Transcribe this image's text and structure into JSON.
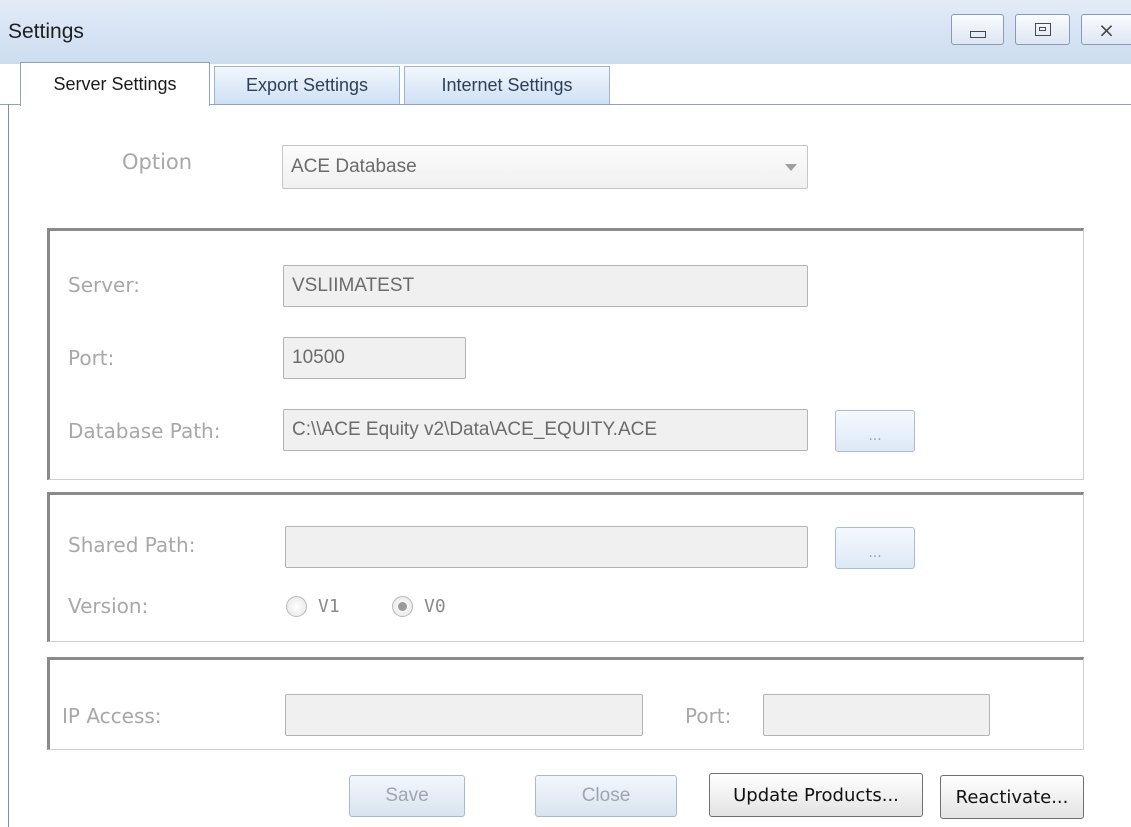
{
  "window": {
    "title": "Settings"
  },
  "tabs": [
    {
      "label": "Server Settings",
      "active": true
    },
    {
      "label": "Export Settings",
      "active": false
    },
    {
      "label": "Internet Settings",
      "active": false
    }
  ],
  "option": {
    "label": "Option",
    "selected": "ACE Database"
  },
  "server_group": {
    "server_label": "Server:",
    "server_value": "VSLIIMATEST",
    "port_label": "Port:",
    "port_value": "10500",
    "db_path_label": "Database Path:",
    "db_path_value": "C:\\\\ACE Equity v2\\Data\\ACE_EQUITY.ACE",
    "browse_label": "..."
  },
  "shared_group": {
    "shared_path_label": "Shared Path:",
    "shared_path_value": "",
    "browse_label": "...",
    "version_label": "Version:",
    "versions": [
      {
        "label": "V1",
        "checked": false
      },
      {
        "label": "V0",
        "checked": true
      }
    ]
  },
  "ip_group": {
    "ip_label": "IP Access:",
    "ip_value": "",
    "port_label": "Port:",
    "port_value": ""
  },
  "buttons": {
    "save": "Save",
    "close": "Close",
    "update_products": "Update Products...",
    "reactivate": "Reactivate..."
  },
  "colors": {
    "disabled_text": "#a8a8a8",
    "titlebar": "#d6e3f4",
    "group_border": "#8a8a8a"
  }
}
